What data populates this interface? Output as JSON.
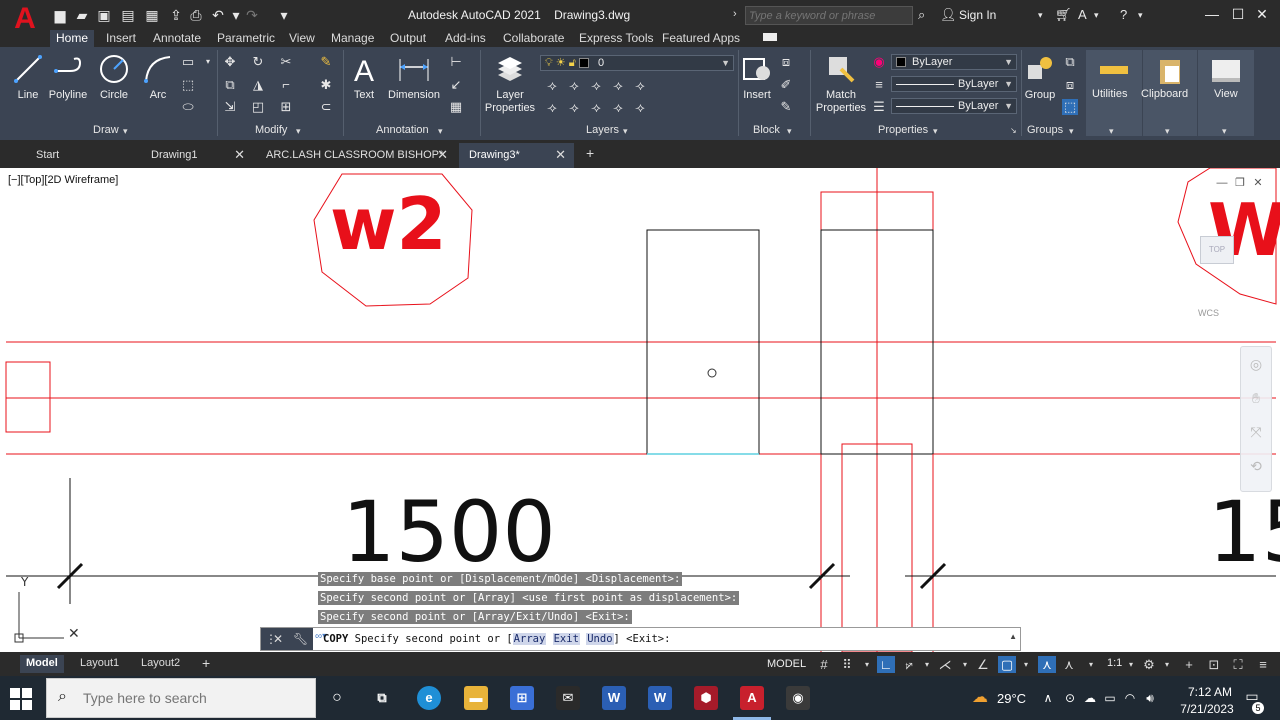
{
  "app": {
    "title": "Autodesk AutoCAD 2021    Drawing3.dwg",
    "logo_letter": "A",
    "brand_color": "#e0121e"
  },
  "search": {
    "placeholder": "Type a keyword or phrase"
  },
  "user": {
    "sign_in_label": "Sign In"
  },
  "ribbon_tabs": [
    "Home",
    "Insert",
    "Annotate",
    "Parametric",
    "View",
    "Manage",
    "Output",
    "Add-ins",
    "Collaborate",
    "Express Tools",
    "Featured Apps"
  ],
  "ribbon": {
    "draw": {
      "title": "Draw",
      "line": "Line",
      "polyline": "Polyline",
      "circle": "Circle",
      "arc": "Arc"
    },
    "modify": {
      "title": "Modify"
    },
    "annotation": {
      "title": "Annotation",
      "text": "Text",
      "dimension": "Dimension"
    },
    "layers": {
      "title": "Layers",
      "layer_properties_1": "Layer",
      "layer_properties_2": "Properties",
      "current_layer": "0"
    },
    "block": {
      "title": "Block",
      "insert": "Insert"
    },
    "properties": {
      "title": "Properties",
      "match_1": "Match",
      "match_2": "Properties",
      "color": "ByLayer",
      "linetype": "ByLayer",
      "lineweight": "ByLayer"
    },
    "groups": {
      "title": "Groups",
      "group": "Group"
    },
    "utilities": "Utilities",
    "clipboard": "Clipboard",
    "view": "View"
  },
  "file_tabs": [
    {
      "label": "Start"
    },
    {
      "label": "Drawing1"
    },
    {
      "label": "ARC.LASH CLASSROOM BISHOP*"
    },
    {
      "label": "Drawing3*"
    }
  ],
  "viewport": {
    "label": "[−][Top][2D Wireframe]",
    "viewcube_top": "TOP",
    "wcs": "WCS"
  },
  "drawing": {
    "dimension_left": "1500",
    "dimension_right": "15",
    "tag_left": "w2",
    "tag_right": "W",
    "line_color": "#e8101a"
  },
  "command_history": [
    "Specify base point or [Displacement/mOde] <Displacement>:",
    "Specify second point or [Array] <use first point as displacement>:",
    "Specify second point or [Array/Exit/Undo] <Exit>:"
  ],
  "command_line": {
    "command": "COPY",
    "prompt_before": " Specify second point or [",
    "opt_array": "Array",
    "opt_exit": "Exit",
    "opt_undo": "Undo",
    "prompt_after": "] <Exit>:"
  },
  "layout_tabs": [
    "Model",
    "Layout1",
    "Layout2"
  ],
  "status": {
    "model": "MODEL",
    "scale": "1:1"
  },
  "taskbar": {
    "search_placeholder": "Type here to search",
    "temperature": "29°C",
    "time": "7:12 AM",
    "date": "7/21/2023",
    "notifications": "5"
  }
}
